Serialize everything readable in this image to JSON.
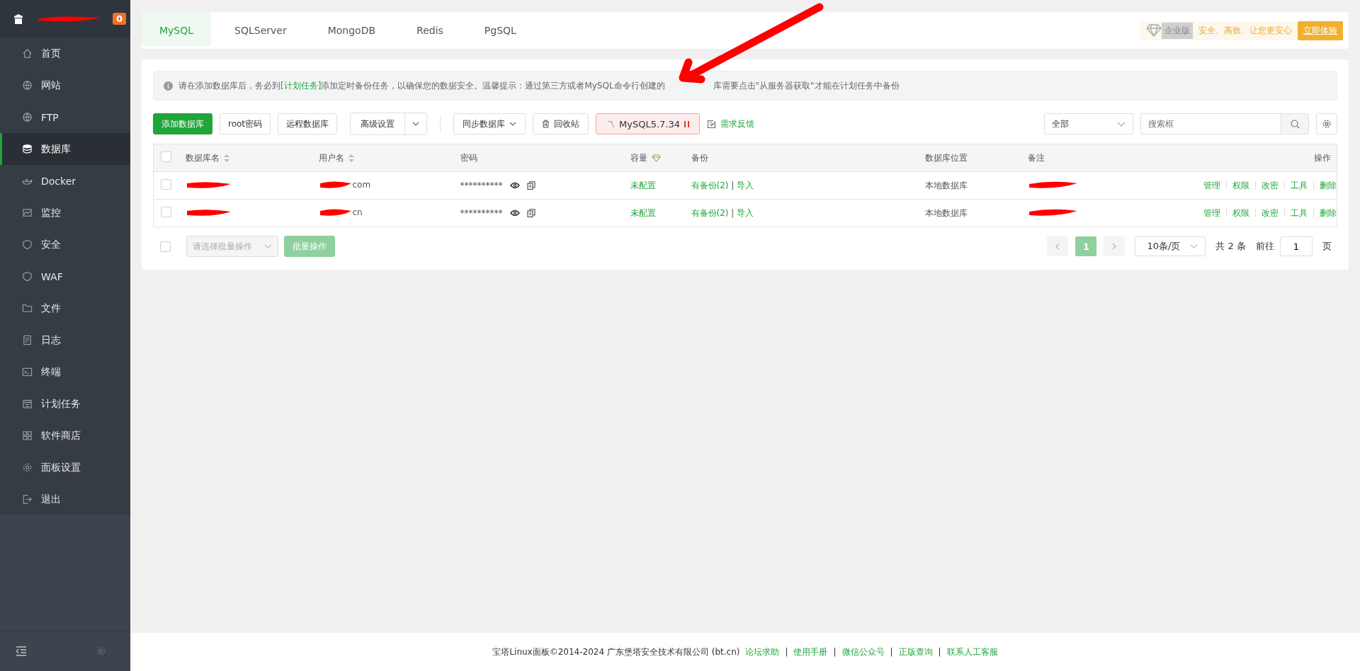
{
  "sidebar": {
    "badge": "0",
    "items": [
      {
        "label": "首页",
        "selected": false
      },
      {
        "label": "网站",
        "selected": false
      },
      {
        "label": "FTP",
        "selected": false
      },
      {
        "label": "数据库",
        "selected": true
      },
      {
        "label": "Docker",
        "selected": false
      },
      {
        "label": "监控",
        "selected": false
      },
      {
        "label": "安全",
        "selected": false
      },
      {
        "label": "WAF",
        "selected": false
      },
      {
        "label": "文件",
        "selected": false
      },
      {
        "label": "日志",
        "selected": false
      },
      {
        "label": "终端",
        "selected": false
      },
      {
        "label": "计划任务",
        "selected": false
      },
      {
        "label": "软件商店",
        "selected": false
      },
      {
        "label": "面板设置",
        "selected": false
      },
      {
        "label": "退出",
        "selected": false
      }
    ]
  },
  "tabs": [
    {
      "label": "MySQL",
      "selected": true
    },
    {
      "label": "SQLServer",
      "selected": false
    },
    {
      "label": "MongoDB",
      "selected": false
    },
    {
      "label": "Redis",
      "selected": false
    },
    {
      "label": "PgSQL",
      "selected": false
    }
  ],
  "promo": {
    "tag": "企业版",
    "slogan": "安全、高效、让您更安心",
    "button": "立即体验"
  },
  "notice": {
    "before": "请在添加数据库后，务必到",
    "link": "[计划任务]",
    "after": "添加定时备份任务，以确保您的数据安全。温馨提示：通过第三方或者MySQL命令行创建的",
    "rest": "库需要点击\"从服务器获取\"才能在计划任务中备份"
  },
  "toolbar": {
    "add": "添加数据库",
    "root": "root密码",
    "remote": "远程数据库",
    "advanced": "高级设置",
    "sync": "同步数据库",
    "recycle": "回收站",
    "version": "MySQL5.7.34",
    "feedback": "需求反馈",
    "filter": "全部",
    "search_placeholder": "搜索框"
  },
  "table": {
    "select_all": {
      "checked": false
    },
    "columns": [
      {
        "label": "数据库名",
        "kind": "sort"
      },
      {
        "label": "用户名",
        "kind": "sort"
      },
      {
        "label": "密码",
        "kind": "plain"
      },
      {
        "label": "容量",
        "kind": "pro"
      },
      {
        "label": "备份",
        "kind": "plain"
      },
      {
        "label": "数据库位置",
        "kind": "plain"
      },
      {
        "label": "备注",
        "kind": "plain"
      },
      {
        "label": "操作",
        "kind": "plain"
      }
    ],
    "rows": [
      {
        "checked": false,
        "user": "com",
        "password": "**********",
        "capacity": "未配置",
        "backup": "有备份(2)",
        "separator": "|",
        "import": "导入",
        "location": "本地数据库",
        "actions": [
          "管理",
          "权限",
          "改密",
          "工具",
          "删除"
        ]
      },
      {
        "checked": false,
        "user": "cn",
        "password": "**********",
        "capacity": "未配置",
        "backup": "有备份(2)",
        "separator": "|",
        "import": "导入",
        "location": "本地数据库",
        "actions": [
          "管理",
          "权限",
          "改密",
          "工具",
          "删除"
        ]
      }
    ]
  },
  "batch": {
    "checked": false,
    "placeholder": "请选择批量操作",
    "button": "批量操作"
  },
  "pager": {
    "pages": [
      {
        "label": "1",
        "selected": true
      }
    ],
    "size": "10条/页",
    "total": "共 2 条",
    "goto": "前往",
    "page": "1",
    "unit": "页"
  },
  "footer": {
    "copyright": "宝塔Linux面板©2014-2024 广东堡塔安全技术有限公司 (bt.cn)",
    "separator": "|",
    "links": [
      "论坛求助",
      "使用手册",
      "微信公众号",
      "正版查询",
      "联系人工客服"
    ]
  }
}
